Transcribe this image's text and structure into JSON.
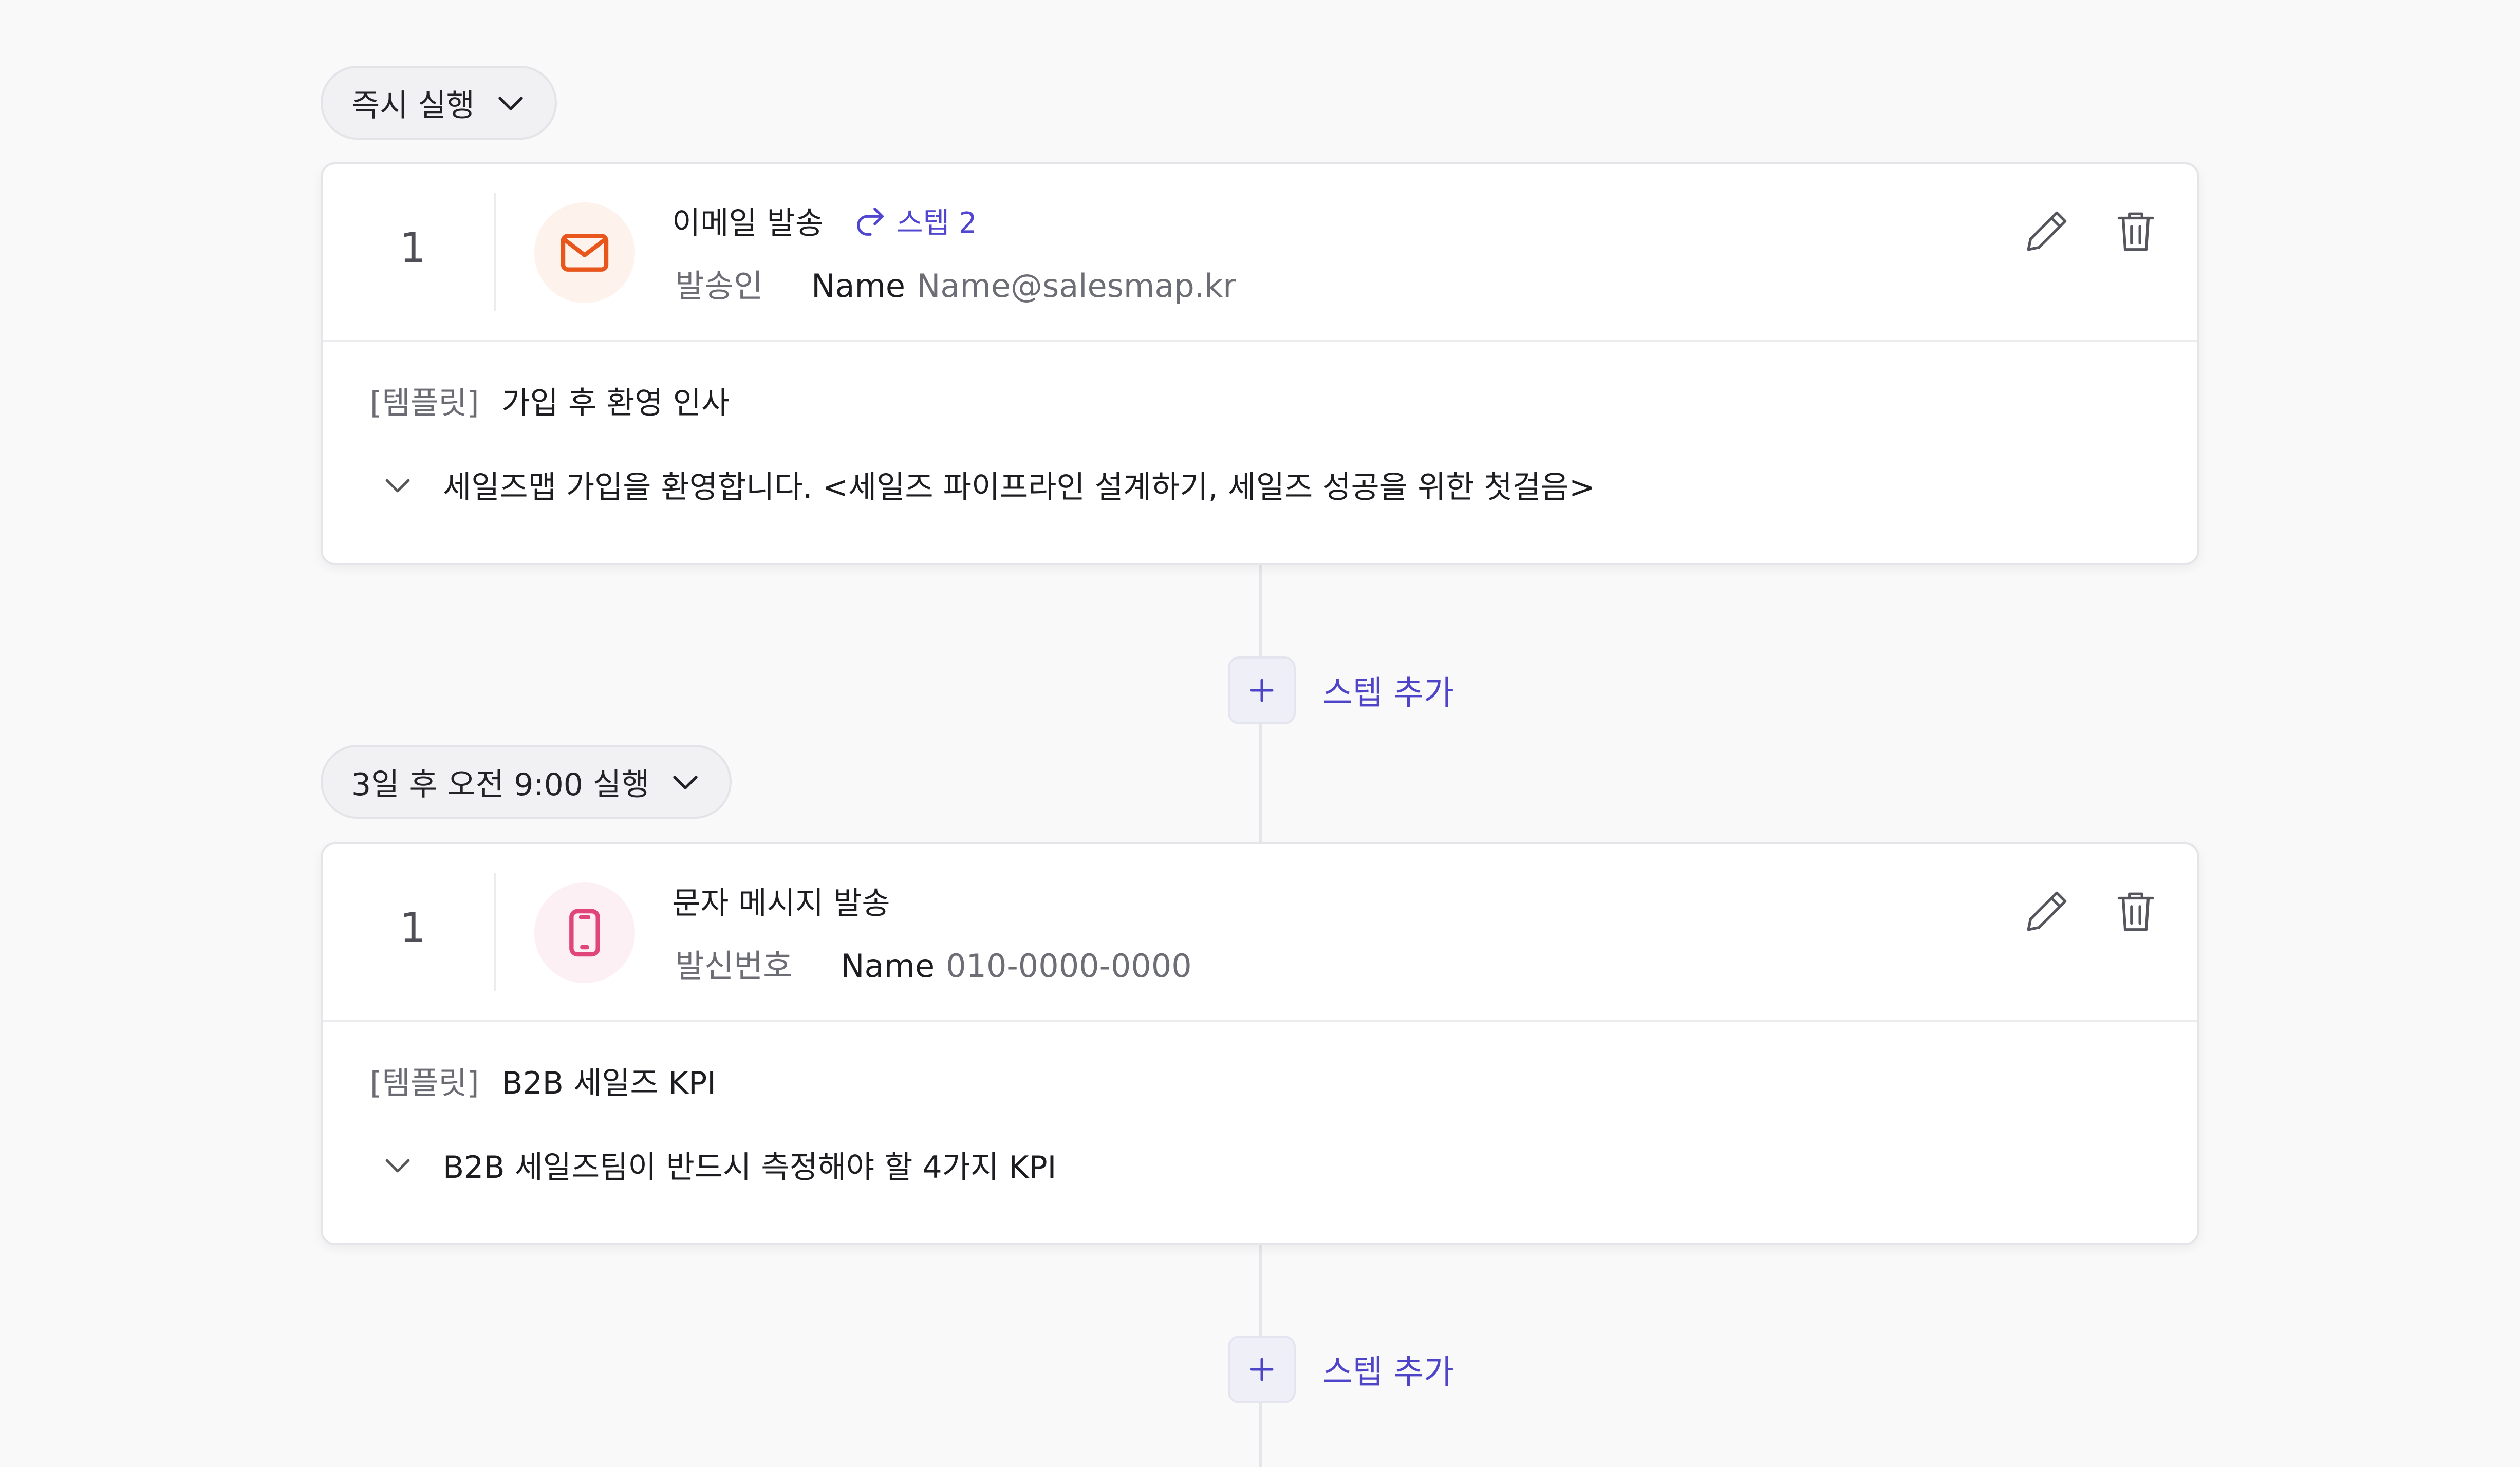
{
  "colors": {
    "accent": "#5146cf",
    "email_icon": "#e8561c",
    "email_icon_bg": "#fdf2ec",
    "sms_icon": "#e1467a",
    "sms_icon_bg": "#fdf0f4"
  },
  "blocks": [
    {
      "trigger_label": "즉시 실행",
      "step_number": "1",
      "channel_icon": "mail-icon",
      "title": "이메일 발송",
      "step_link": "스텝 2",
      "sender_label": "발송인",
      "sender_name": "Name",
      "sender_value": "Name@salesmap.kr",
      "template_label": "[템플릿]",
      "template_name": "가입 후 환영 인사",
      "subject": "세일즈맵 가입을 환영합니다. <세일즈 파이프라인 설계하기, 세일즈 성공을 위한 첫걸음>",
      "add_step_label": "스텝 추가"
    },
    {
      "trigger_label": "3일 후 오전 9:00 실행",
      "step_number": "1",
      "channel_icon": "phone-icon",
      "title": "문자 메시지 발송",
      "sender_label": "발신번호",
      "sender_name": "Name",
      "sender_value": "010-0000-0000",
      "template_label": "[템플릿]",
      "template_name": "B2B 세일즈 KPI",
      "subject": "B2B 세일즈팀이 반드시 측정해야 할 4가지 KPI",
      "add_step_label": "스텝 추가"
    }
  ]
}
